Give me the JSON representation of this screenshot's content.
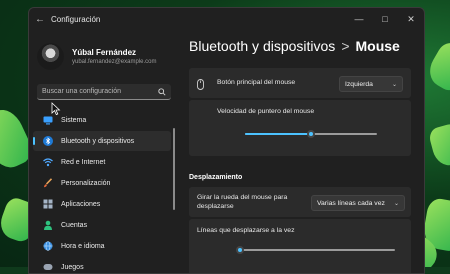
{
  "window": {
    "title": "Configuración"
  },
  "profile": {
    "name": "Yúbal Fernández",
    "email": "yubal.fernandez@example.com"
  },
  "search": {
    "placeholder": "Buscar una configuración"
  },
  "sidebar": {
    "items": [
      {
        "label": "Sistema",
        "icon": "monitor-icon",
        "active": false
      },
      {
        "label": "Bluetooth y dispositivos",
        "icon": "bluetooth-icon",
        "active": true
      },
      {
        "label": "Red e Internet",
        "icon": "wifi-icon",
        "active": false
      },
      {
        "label": "Personalización",
        "icon": "brush-icon",
        "active": false
      },
      {
        "label": "Aplicaciones",
        "icon": "apps-icon",
        "active": false
      },
      {
        "label": "Cuentas",
        "icon": "account-icon",
        "active": false
      },
      {
        "label": "Hora e idioma",
        "icon": "globe-icon",
        "active": false
      },
      {
        "label": "Juegos",
        "icon": "gamepad-icon",
        "active": false
      }
    ]
  },
  "breadcrumb": {
    "parent": "Bluetooth y dispositivos",
    "separator": ">",
    "current": "Mouse"
  },
  "settings": {
    "primary_button": {
      "label": "Botón principal del mouse",
      "value": "Izquierda"
    },
    "pointer_speed": {
      "label": "Velocidad de puntero del mouse",
      "value": 0.5
    },
    "scroll_section": "Desplazamiento",
    "wheel_scroll": {
      "label": "Girar la rueda del mouse para desplazarse",
      "value": "Varias líneas cada vez"
    },
    "lines_to_scroll": {
      "label": "Líneas que desplazarse a la vez",
      "value": 0.02
    }
  },
  "colors": {
    "accent": "#4cc2ff",
    "background": "#202020",
    "card": "#2b2b2b"
  }
}
